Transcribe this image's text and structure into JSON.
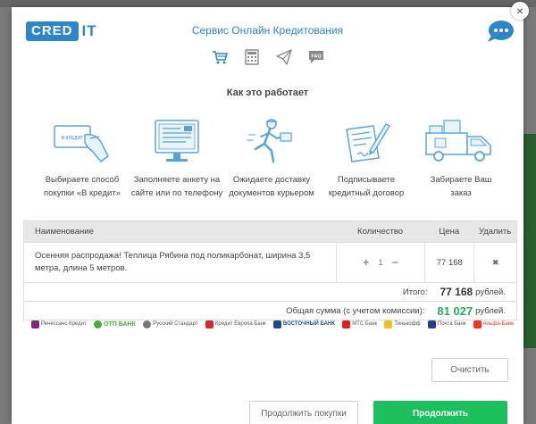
{
  "modal": {
    "logo_box": "CRED",
    "logo_rest": "IT",
    "title": "Сервис Онлайн Кредитования",
    "close": "×"
  },
  "tabs": [
    {
      "icon": "cart-icon"
    },
    {
      "icon": "calculator-icon"
    },
    {
      "icon": "paper-plane-icon"
    },
    {
      "icon": "faq-icon",
      "label": "FAQ"
    }
  ],
  "how_it_works": {
    "title": "Как это работает",
    "steps": [
      {
        "icon": "card-hand-icon",
        "badge": "В КРЕДИТ",
        "text_1": "Выбираете способ",
        "text_2": "покупки «В кредит»"
      },
      {
        "icon": "monitor-form-icon",
        "text_1": "Заполняете анкету на",
        "text_2": "сайте или по телефону"
      },
      {
        "icon": "courier-icon",
        "text_1": "Ожидаете доставку",
        "text_2": "документов курьером"
      },
      {
        "icon": "signing-document-icon",
        "text_1": "Подписываете",
        "text_2": "кредитный договор"
      },
      {
        "icon": "delivery-truck-icon",
        "text_1": "Забираете Ваш",
        "text_2": "заказ"
      }
    ]
  },
  "cart": {
    "headers": {
      "name": "Наименование",
      "qty": "Количество",
      "price": "Цена",
      "delete": "Удалить"
    },
    "rows": [
      {
        "name_1": "Осенняя распродажа! Теплица Рябина под поликарбонат, ширина 3,5",
        "name_2": "метра, длина 5 метров.",
        "qty": "1",
        "price": "77 168",
        "minus": "−",
        "plus": "+",
        "delete": "✖"
      }
    ],
    "total_label": "Итого:",
    "total_value": "77 168",
    "total_unit": "рублей.",
    "grand_label": "Общая сумма (с учетом комиссии):",
    "grand_value": "81 027",
    "grand_unit": "рублей."
  },
  "banks": [
    {
      "name": "Ренессанс Кредит",
      "color": "#7a2a7c"
    },
    {
      "name": "ОТП БАНК",
      "color": "#4caa3c"
    },
    {
      "name": "Русский Стандарт",
      "color": "#777777"
    },
    {
      "name": "Кредит Европа Банк",
      "color": "#d12a2a"
    },
    {
      "name": "ВОСТОЧНЫЙ БАНК",
      "color": "#1f4a8c"
    },
    {
      "name": "МТС Банк",
      "color": "#e02020"
    },
    {
      "name": "Тинькофф",
      "color": "#f2c21a"
    },
    {
      "name": "Почта Банк",
      "color": "#2a3c8c"
    },
    {
      "name": "Альфа-Банк",
      "color": "#ef3124"
    }
  ],
  "buttons": {
    "clear": "Очистить",
    "continue_shopping": "Продолжить покупки",
    "continue": "Продолжить"
  },
  "colors": {
    "accent": "#2e86c9",
    "green": "#1bbf5c"
  }
}
